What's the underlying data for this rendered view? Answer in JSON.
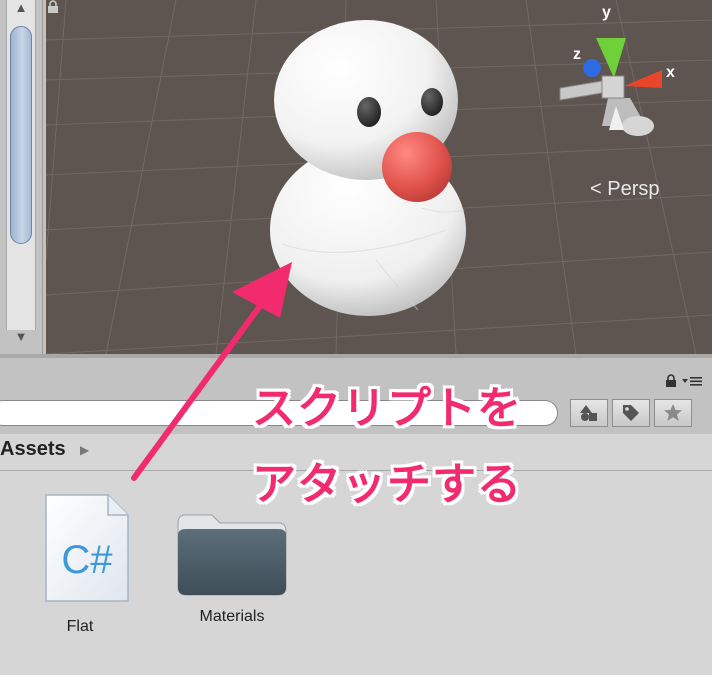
{
  "scene_view": {
    "projection_label": "Persp",
    "axes": {
      "x": "x",
      "y": "y",
      "z": "z"
    },
    "colors": {
      "background": "#5e5450",
      "x_axis": "#e8452a",
      "y_axis": "#6fd13a",
      "z_axis": "#2e6be0",
      "nose": "#e2544d"
    }
  },
  "scrollbar": {
    "up_arrow": "▲",
    "down_arrow": "▼"
  },
  "project_panel": {
    "panel_menu_icons": [
      "lock-icon",
      "menu-icon"
    ],
    "toolbar": {
      "buttons": [
        "filter-by-type-icon",
        "filter-by-label-icon",
        "favorite-star-icon"
      ]
    },
    "breadcrumb": {
      "root": "Assets",
      "arrow": "▶"
    },
    "assets": [
      {
        "name": "Flat",
        "kind": "script",
        "glyph": "C#"
      },
      {
        "name": "Materials",
        "kind": "folder"
      }
    ]
  },
  "annotation": {
    "line1": "スクリプトを",
    "line2": "アタッチする",
    "color": "#f12b6e"
  }
}
